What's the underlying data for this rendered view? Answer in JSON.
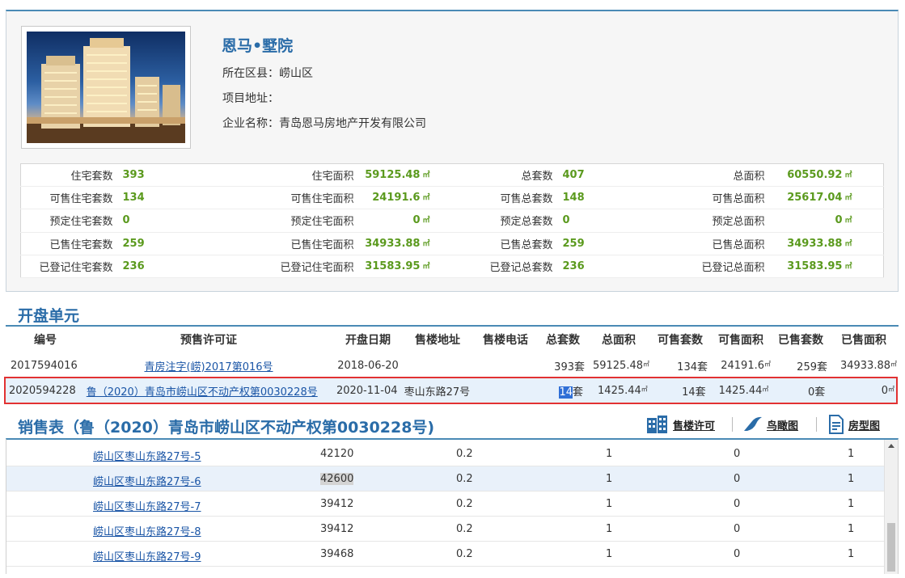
{
  "project": {
    "name": "恩马•墅院",
    "district_label": "所在区县：",
    "district": "崂山区",
    "address_label": "项目地址：",
    "address": "",
    "company_label": "企业名称：",
    "company": "青岛恩马房地产开发有限公司"
  },
  "stats": [
    [
      {
        "k": "住宅套数",
        "v": "393",
        "u": ""
      },
      {
        "k": "住宅面积",
        "v": "59125.48",
        "u": "㎡"
      },
      {
        "k": "总套数",
        "v": "407",
        "u": ""
      },
      {
        "k": "总面积",
        "v": "60550.92",
        "u": "㎡"
      }
    ],
    [
      {
        "k": "可售住宅套数",
        "v": "134",
        "u": ""
      },
      {
        "k": "可售住宅面积",
        "v": "24191.6",
        "u": "㎡"
      },
      {
        "k": "可售总套数",
        "v": "148",
        "u": ""
      },
      {
        "k": "可售总面积",
        "v": "25617.04",
        "u": "㎡"
      }
    ],
    [
      {
        "k": "预定住宅套数",
        "v": "0",
        "u": ""
      },
      {
        "k": "预定住宅面积",
        "v": "0",
        "u": "㎡"
      },
      {
        "k": "预定总套数",
        "v": "0",
        "u": ""
      },
      {
        "k": "预定总面积",
        "v": "0",
        "u": "㎡"
      }
    ],
    [
      {
        "k": "已售住宅套数",
        "v": "259",
        "u": ""
      },
      {
        "k": "已售住宅面积",
        "v": "34933.88",
        "u": "㎡"
      },
      {
        "k": "已售总套数",
        "v": "259",
        "u": ""
      },
      {
        "k": "已售总面积",
        "v": "34933.88",
        "u": "㎡"
      }
    ],
    [
      {
        "k": "已登记住宅套数",
        "v": "236",
        "u": ""
      },
      {
        "k": "已登记住宅面积",
        "v": "31583.95",
        "u": "㎡"
      },
      {
        "k": "已登记总套数",
        "v": "236",
        "u": ""
      },
      {
        "k": "已登记总面积",
        "v": "31583.95",
        "u": "㎡"
      }
    ]
  ],
  "units_section": {
    "title": "开盘单元",
    "headers": [
      "编号",
      "预售许可证",
      "开盘日期",
      "售楼地址",
      "售楼电话",
      "总套数",
      "总面积",
      "可售套数",
      "可售面积",
      "已售套数",
      "已售面积"
    ],
    "rows": [
      {
        "id": "2017594016",
        "permit": "青房注字(崂)2017第016号",
        "date": "2018-06-20",
        "addr": "",
        "phone": "",
        "total": "393套",
        "area": "59125.48",
        "avail": "134套",
        "avail_area": "24191.6",
        "sold": "259套",
        "sold_area": "34933.88"
      },
      {
        "id": "2020594228",
        "permit": "鲁（2020）青岛市崂山区不动产权第0030228号",
        "date": "2020-11-04",
        "addr": "枣山东路27号",
        "phone": "",
        "total_sel": "14",
        "total_suffix": "套",
        "area": "1425.44",
        "avail": "14套",
        "avail_area": "1425.44",
        "sold": "0套",
        "sold_area": "0"
      }
    ],
    "unit_sq": "㎡"
  },
  "sales": {
    "title": "销售表（鲁（2020）青岛市崂山区不动产权第0030228号)",
    "tools": {
      "permit": "售楼许可",
      "aerial": "鸟瞰图",
      "floorplan": "房型图"
    },
    "rows": [
      {
        "name": "崂山区枣山东路27号-5",
        "area": "42120",
        "ratio": "0.2",
        "a": "1",
        "b": "0",
        "c": "1"
      },
      {
        "name": "崂山区枣山东路27号-6",
        "area": "42600",
        "ratio": "0.2",
        "a": "1",
        "b": "0",
        "c": "1"
      },
      {
        "name": "崂山区枣山东路27号-7",
        "area": "39412",
        "ratio": "0.2",
        "a": "1",
        "b": "0",
        "c": "1"
      },
      {
        "name": "崂山区枣山东路27号-8",
        "area": "39412",
        "ratio": "0.2",
        "a": "1",
        "b": "0",
        "c": "1"
      },
      {
        "name": "崂山区枣山东路27号-9",
        "area": "39468",
        "ratio": "0.2",
        "a": "1",
        "b": "0",
        "c": "1"
      }
    ]
  }
}
